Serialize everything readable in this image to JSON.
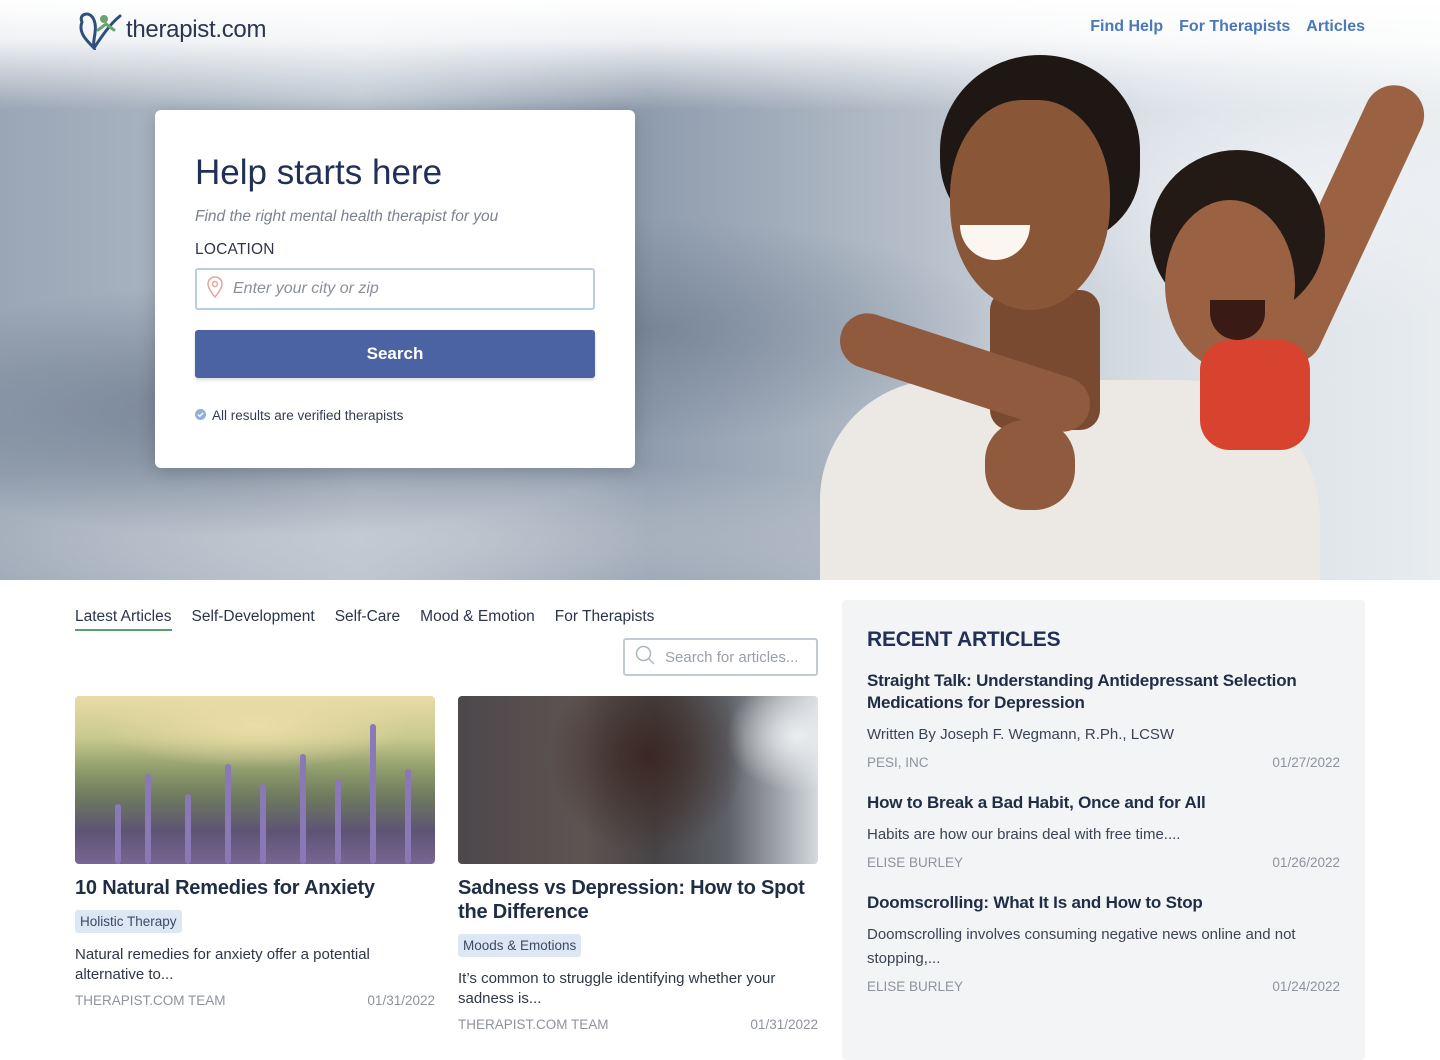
{
  "brand": {
    "name": "therapist",
    "tld": ".com"
  },
  "nav": {
    "items": [
      "Find Help",
      "For Therapists",
      "Articles"
    ]
  },
  "hero": {
    "title": "Help starts here",
    "subtitle": "Find the right mental health therapist for you",
    "location_label": "LOCATION",
    "location_placeholder": "Enter your city or zip",
    "search_label": "Search",
    "verified_text": "All results are verified therapists"
  },
  "articles": {
    "tabs": [
      "Latest Articles",
      "Self-Development",
      "Self-Care",
      "Mood & Emotion",
      "For Therapists"
    ],
    "active_tab": "Latest Articles",
    "search_placeholder": "Search for articles...",
    "cards": [
      {
        "title": "10 Natural Remedies for Anxiety",
        "tag": "Holistic Therapy",
        "excerpt": "Natural remedies for anxiety offer a potential alternative to...",
        "author": "THERAPIST.COM TEAM",
        "date": "01/31/2022"
      },
      {
        "title": "Sadness vs Depression: How to Spot the Difference",
        "tag": "Moods & Emotions",
        "excerpt": "It’s common to struggle identifying whether your sadness is...",
        "author": "THERAPIST.COM TEAM",
        "date": "01/31/2022"
      }
    ]
  },
  "recent": {
    "heading": "RECENT ARTICLES",
    "items": [
      {
        "title": "Straight Talk: Understanding Antidepressant Selection Medications for Depression",
        "desc": "Written By Joseph F. Wegmann, R.Ph., LCSW",
        "author": "PESI, INC",
        "date": "01/27/2022"
      },
      {
        "title": "How to Break a Bad Habit, Once and for All",
        "desc": "Habits are how our brains deal with free time....",
        "author": "ELISE BURLEY",
        "date": "01/26/2022"
      },
      {
        "title": "Doomscrolling: What It Is and How to Stop",
        "desc": "Doomscrolling involves consuming negative news online and not stopping,...",
        "author": "ELISE BURLEY",
        "date": "01/24/2022"
      }
    ]
  },
  "colors": {
    "accent": "#4b63a3",
    "nav_link": "#4b78b6",
    "tag_bg": "#dde7f4",
    "active_tab_underline": "#5aa06c"
  },
  "icons": [
    "logo-heart-icon",
    "map-pin-icon",
    "verified-check-icon",
    "search-icon"
  ]
}
